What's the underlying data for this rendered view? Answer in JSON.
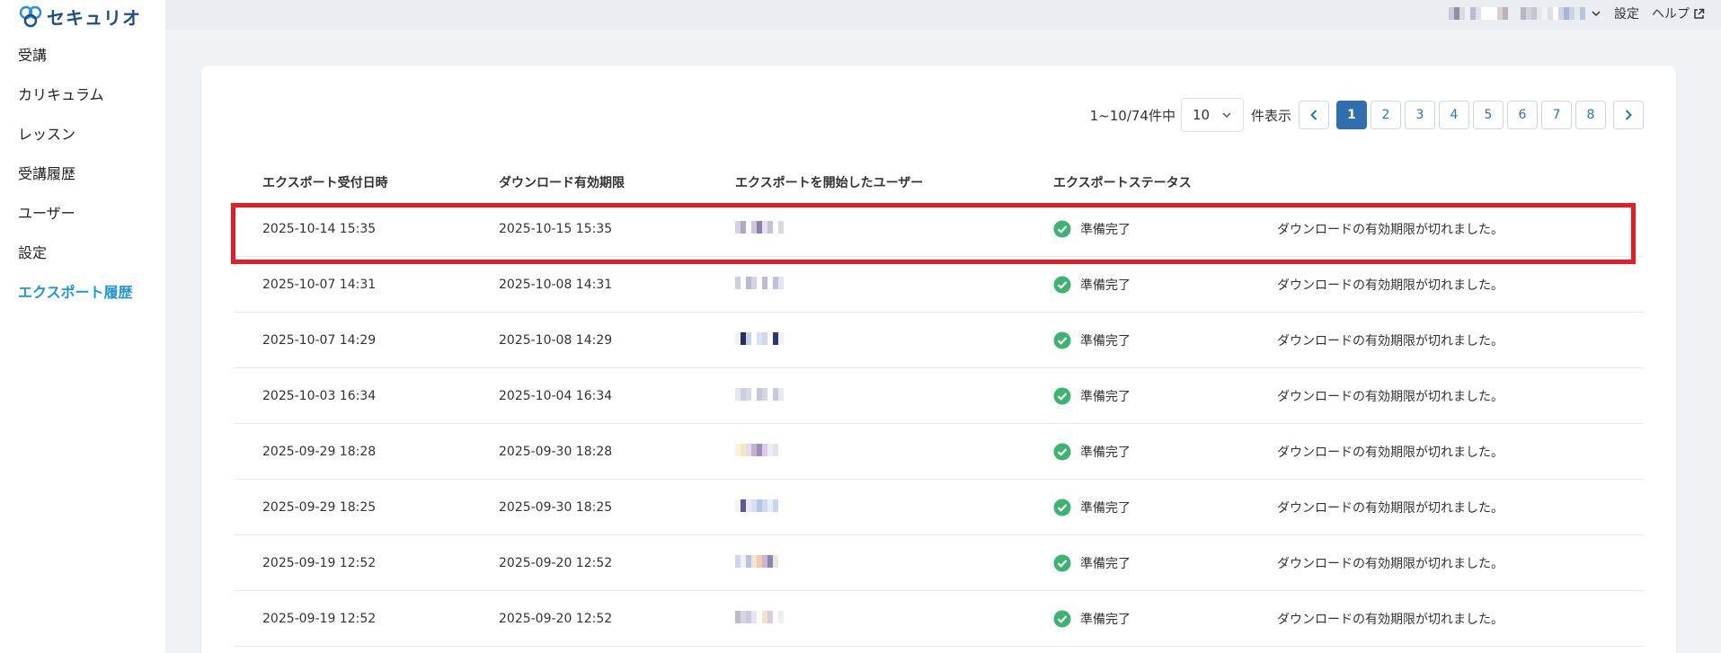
{
  "logo": {
    "text": "セキュリオ"
  },
  "nav": {
    "items": [
      {
        "label": "受講"
      },
      {
        "label": "カリキュラム"
      },
      {
        "label": "レッスン"
      },
      {
        "label": "受講履歴"
      },
      {
        "label": "ユーザー"
      },
      {
        "label": "設定"
      },
      {
        "label": "エクスポート履歴",
        "active": true
      }
    ]
  },
  "topbar": {
    "settings_label": "設定",
    "help_label": "ヘルプ"
  },
  "pagination": {
    "range_text": "1~10/74件中",
    "per_page_value": "10",
    "per_page_label": "件表示",
    "pages": [
      "1",
      "2",
      "3",
      "4",
      "5",
      "6",
      "7",
      "8"
    ],
    "current_page": "1"
  },
  "table": {
    "headers": {
      "received_at": "エクスポート受付日時",
      "expires_at": "ダウンロード有効期限",
      "started_by": "エクスポートを開始したユーザー",
      "status": "エクスポートステータス"
    },
    "rows": [
      {
        "received_at": "2025-10-14 15:35",
        "expires_at": "2025-10-15 15:35",
        "status": "準備完了",
        "note": "ダウンロードの有効期限が切れました。"
      },
      {
        "received_at": "2025-10-07 14:31",
        "expires_at": "2025-10-08 14:31",
        "status": "準備完了",
        "note": "ダウンロードの有効期限が切れました。"
      },
      {
        "received_at": "2025-10-07 14:29",
        "expires_at": "2025-10-08 14:29",
        "status": "準備完了",
        "note": "ダウンロードの有効期限が切れました。"
      },
      {
        "received_at": "2025-10-03 16:34",
        "expires_at": "2025-10-04 16:34",
        "status": "準備完了",
        "note": "ダウンロードの有効期限が切れました。"
      },
      {
        "received_at": "2025-09-29 18:28",
        "expires_at": "2025-09-30 18:28",
        "status": "準備完了",
        "note": "ダウンロードの有効期限が切れました。"
      },
      {
        "received_at": "2025-09-29 18:25",
        "expires_at": "2025-09-30 18:25",
        "status": "準備完了",
        "note": "ダウンロードの有効期限が切れました。"
      },
      {
        "received_at": "2025-09-19 12:52",
        "expires_at": "2025-09-20 12:52",
        "status": "準備完了",
        "note": "ダウンロードの有効期限が切れました。"
      },
      {
        "received_at": "2025-09-19 12:52",
        "expires_at": "2025-09-20 12:52",
        "status": "準備完了",
        "note": "ダウンロードの有効期限が切れました。"
      }
    ]
  },
  "colors": {
    "accent": "#1f97d6",
    "page_active": "#2f6fb0",
    "status_ok": "#3cb371",
    "highlight": "#e51c23"
  }
}
